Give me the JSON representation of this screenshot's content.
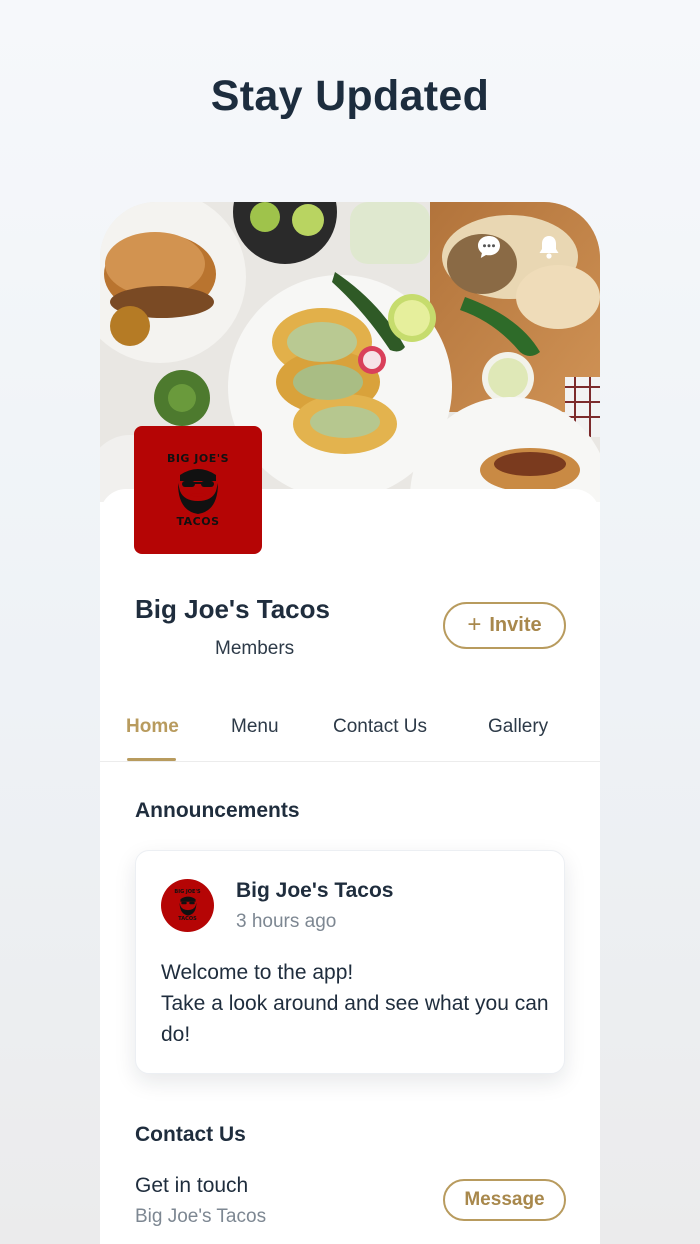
{
  "headline": "Stay Updated",
  "hero": {
    "chat_icon": "chat-bubble-icon",
    "bell_icon": "bell-icon"
  },
  "business": {
    "name": "Big Joe's Tacos",
    "members_label": "Members",
    "logo_top_text": "BIG JOE'S",
    "logo_bottom_text": "TACOS",
    "invite_label": "Invite",
    "invite_icon": "plus-icon"
  },
  "tabs": [
    {
      "label": "Home",
      "active": true
    },
    {
      "label": "Menu",
      "active": false
    },
    {
      "label": "Contact Us",
      "active": false
    },
    {
      "label": "Gallery",
      "active": false
    }
  ],
  "announcements": {
    "title": "Announcements",
    "post": {
      "author": "Big Joe's Tacos",
      "time": "3 hours ago",
      "line1": "Welcome to the app!",
      "line2": "Take a look around and see what you can do!"
    }
  },
  "contact": {
    "title": "Contact Us",
    "subtitle": "Get in touch",
    "name": "Big Joe's Tacos",
    "button_label": "Message"
  },
  "colors": {
    "accent": "#b89b5e",
    "logo_red": "#b50505",
    "text_dark": "#1f2d3d"
  }
}
